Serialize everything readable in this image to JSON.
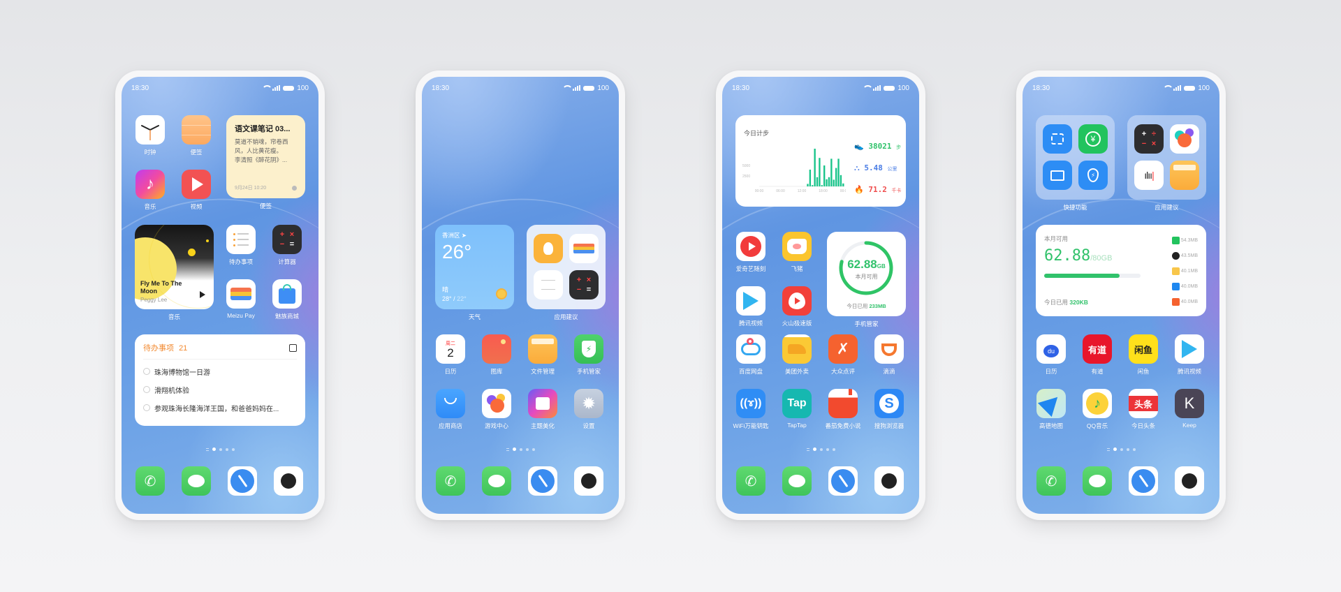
{
  "status_bar": {
    "time": "18:30",
    "battery": "100"
  },
  "page_indicator": {
    "pages": 5,
    "active": 1
  },
  "dock": [
    {
      "name": "phone",
      "icon": "phone-icon"
    },
    {
      "name": "messages",
      "icon": "message-icon"
    },
    {
      "name": "browser",
      "icon": "compass-icon"
    },
    {
      "name": "camera",
      "icon": "camera-icon"
    }
  ],
  "screen1": {
    "apps": [
      {
        "label": "时钟",
        "icon": "clock-icon"
      },
      {
        "label": "便签",
        "icon": "notes-icon"
      },
      {
        "label": "音乐",
        "icon": "music-icon"
      },
      {
        "label": "视频",
        "icon": "video-icon"
      },
      {
        "label": "待办事项",
        "icon": "todo-icon"
      },
      {
        "label": "计算器",
        "icon": "calculator-icon"
      },
      {
        "label": "Meizu Pay",
        "icon": "wallet-icon"
      },
      {
        "label": "魅族商城",
        "icon": "shopping-bag-icon"
      }
    ],
    "note_widget": {
      "title": "语文课笔记 03...",
      "body_line1": "莫道不销魂，帘卷西",
      "body_line2": "风，人比黄花瘦。",
      "body_line3": "李清照《醉花阴》...",
      "date": "9月24日 10:20",
      "label": "便签"
    },
    "music_widget": {
      "song": "Fly Me To The Moon",
      "artist": "Peggy Lee",
      "label": "音乐"
    },
    "todo_widget": {
      "title": "待办事项",
      "count": "21",
      "items": [
        "珠海博物馆一日游",
        "滑翔机体验",
        "参观珠海长隆海洋王国，和爸爸妈妈在..."
      ]
    }
  },
  "screen2": {
    "weather_widget": {
      "location": "香洲区",
      "temp": "26°",
      "condition": "晴",
      "high": "28°",
      "low": "22°",
      "label": "天气"
    },
    "suggest_widget": {
      "label": "应用建议"
    },
    "apps": [
      {
        "label": "日历",
        "icon": "calendar-icon",
        "weekday": "周二",
        "day": "2"
      },
      {
        "label": "图库",
        "icon": "gallery-icon"
      },
      {
        "label": "文件管理",
        "icon": "folder-icon"
      },
      {
        "label": "手机管家",
        "icon": "shield-icon"
      },
      {
        "label": "应用商店",
        "icon": "app-store-icon"
      },
      {
        "label": "游戏中心",
        "icon": "game-center-icon"
      },
      {
        "label": "主题美化",
        "icon": "theme-icon"
      },
      {
        "label": "设置",
        "icon": "settings-icon"
      }
    ]
  },
  "screen3": {
    "steps_widget": {
      "title": "今日计步",
      "steps": "38021",
      "steps_unit": "步",
      "distance": "5.48",
      "distance_unit": "公里",
      "calories": "71.2",
      "calories_unit": "千卡",
      "y_ticks": [
        "5000",
        "2500"
      ],
      "x_ticks": [
        "00:00",
        "06:00",
        "12:00",
        "18:00",
        "00:00"
      ],
      "bars": [
        0,
        0,
        0,
        0,
        0,
        0,
        0,
        0,
        0,
        0,
        0,
        0,
        0,
        0,
        0,
        0,
        0,
        0,
        0,
        0,
        600,
        4000,
        300,
        9000,
        2200,
        6800,
        300,
        5000,
        1700,
        2200,
        6600,
        1600,
        4400,
        6600,
        2700,
        700
      ]
    },
    "data_widget": {
      "value": "62.88",
      "unit": "GB",
      "caption": "本月可用",
      "today_label": "今日已用",
      "today_value": "233MB",
      "ring_fraction": 0.79,
      "label": "手机管家"
    },
    "apps_top": [
      {
        "label": "爱奇艺随刻",
        "icon": "iqiyi-icon"
      },
      {
        "label": "飞猪",
        "icon": "fliggy-icon"
      },
      {
        "label": "腾讯视频",
        "icon": "tencent-video-icon"
      },
      {
        "label": "火山极速版",
        "icon": "huoshan-icon"
      }
    ],
    "apps": [
      {
        "label": "百度网盘",
        "icon": "baidu-netdisk-icon"
      },
      {
        "label": "美团外卖",
        "icon": "meituan-icon"
      },
      {
        "label": "大众点评",
        "icon": "dianping-icon"
      },
      {
        "label": "滴滴",
        "icon": "didi-icon"
      },
      {
        "label": "WiFi万能钥匙",
        "icon": "wifi-key-icon"
      },
      {
        "label": "TapTap",
        "icon": "taptap-icon",
        "text": "Tap"
      },
      {
        "label": "番茄免费小说",
        "icon": "fanqie-icon"
      },
      {
        "label": "搜狗浏览器",
        "icon": "sogou-icon"
      }
    ]
  },
  "screen4": {
    "quick_widget": {
      "label": "快捷功能"
    },
    "suggest_widget": {
      "label": "应用建议"
    },
    "data_widget": {
      "caption": "本月可用",
      "value": "62.88",
      "total": "/80GB",
      "progress": 0.786,
      "today_label": "今日已用",
      "today_value": "320KB",
      "apps": [
        {
          "icon": "wechat-icon",
          "usage": "54.3MB"
        },
        {
          "icon": "qq-icon",
          "usage": "43.5MB"
        },
        {
          "icon": "weibo-icon",
          "usage": "40.1MB"
        },
        {
          "icon": "zhihu-icon",
          "usage": "40.0MB"
        },
        {
          "icon": "taobao-icon",
          "usage": "40.0MB"
        }
      ]
    },
    "apps": [
      {
        "label": "日历",
        "icon": "baidu-icon"
      },
      {
        "label": "有道",
        "icon": "youdao-icon",
        "text": "有道"
      },
      {
        "label": "闲鱼",
        "icon": "xianyu-icon",
        "text": "闲鱼"
      },
      {
        "label": "腾讯视频",
        "icon": "tencent-video-icon"
      },
      {
        "label": "高德地图",
        "icon": "amap-icon"
      },
      {
        "label": "QQ音乐",
        "icon": "qqmusic-icon"
      },
      {
        "label": "今日头条",
        "icon": "toutiao-icon",
        "text": "头条"
      },
      {
        "label": "Keep",
        "icon": "keep-icon",
        "text": "K"
      }
    ]
  }
}
